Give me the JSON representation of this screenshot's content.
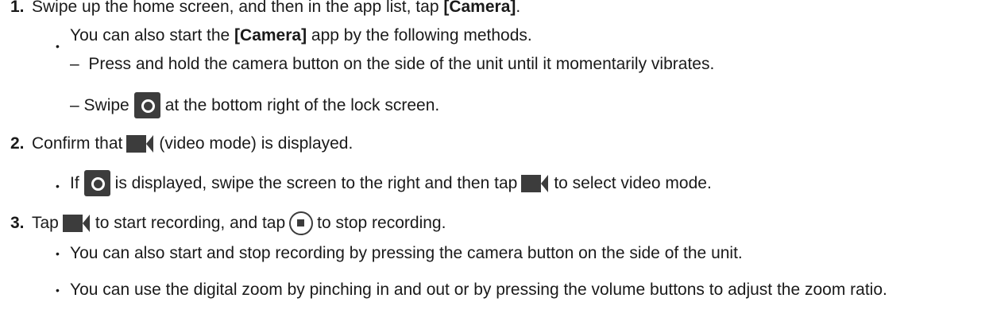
{
  "steps": [
    {
      "num": "1.",
      "text_before": "Swipe up the home screen, and then in the app list, tap ",
      "bold": "[Camera]",
      "text_after": "."
    },
    {
      "num": "2.",
      "text_before": "Confirm that ",
      "text_after": " (video mode) is displayed."
    },
    {
      "num": "3.",
      "text_before": "Tap ",
      "text_mid": " to start recording, and tap ",
      "text_after": " to stop recording."
    }
  ],
  "step1_bullet": {
    "before": "You can also start the ",
    "bold": "[Camera]",
    "after": " app by the following methods."
  },
  "step1_dashes": [
    "Press and hold the camera button on the side of the unit until it momentarily vibrates.",
    {
      "before": "Swipe ",
      "after": " at the bottom right of the lock screen."
    }
  ],
  "step2_bullet": {
    "before": "If ",
    "mid": " is displayed, swipe the screen to the right and then tap ",
    "after": " to select video mode."
  },
  "step3_bullets": [
    "You can also start and stop recording by pressing the camera button on the side of the unit.",
    "You can use the digital zoom by pinching in and out or by pressing the volume buttons to adjust the zoom ratio."
  ],
  "symbols": {
    "bullet": "•",
    "dash": "–"
  },
  "icons": {
    "camera": "camera-shutter-icon",
    "video": "video-camera-icon",
    "stop": "stop-record-icon"
  },
  "colors": {
    "text": "#1a1a1a",
    "icon": "#3c3c3c"
  }
}
